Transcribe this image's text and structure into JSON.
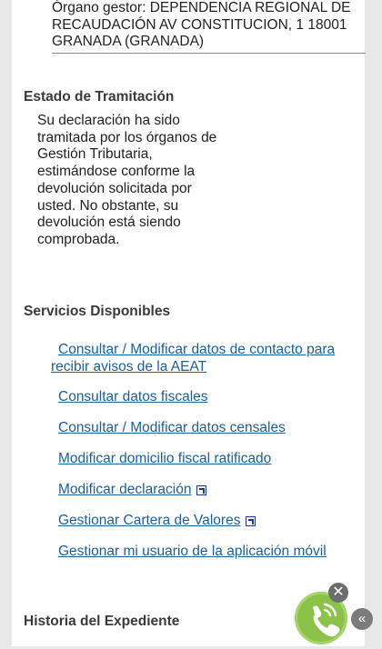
{
  "organo": {
    "text": "Órgano gestor: DEPENDENCIA REGIONAL DE RECAUDACIÓN  AV CONSTITUCION, 1 18001 GRANADA (GRANADA)"
  },
  "estado": {
    "title": "Estado de Tramitación",
    "text": "Su declaración ha sido tramitada por los órganos de Gestión Tributaria, estimándose conforme la devolución solicitada por usted. No obstante, su devolución está siendo comprobada."
  },
  "servicios": {
    "title": "Servicios Disponibles",
    "links": [
      {
        "label": "Consultar / Modificar datos de contacto para recibir avisos de la AEAT"
      },
      {
        "label": "Consultar datos fiscales"
      },
      {
        "label": "Consultar / Modificar datos censales"
      },
      {
        "label": "Modificar domicilio fiscal ratificado"
      },
      {
        "label": "Modificar declaración"
      },
      {
        "label": "Gestionar Cartera de Valores"
      },
      {
        "label": "Gestionar mi usuario de la aplicación móvil"
      }
    ]
  },
  "historia": {
    "title": "Historia del Expediente"
  },
  "floating": {
    "phone_icon": "phone-icon",
    "close_glyph": "✕",
    "collapse_glyph": "«"
  },
  "colors": {
    "link": "#1e5f95",
    "phone_button": "#8bc34a"
  }
}
